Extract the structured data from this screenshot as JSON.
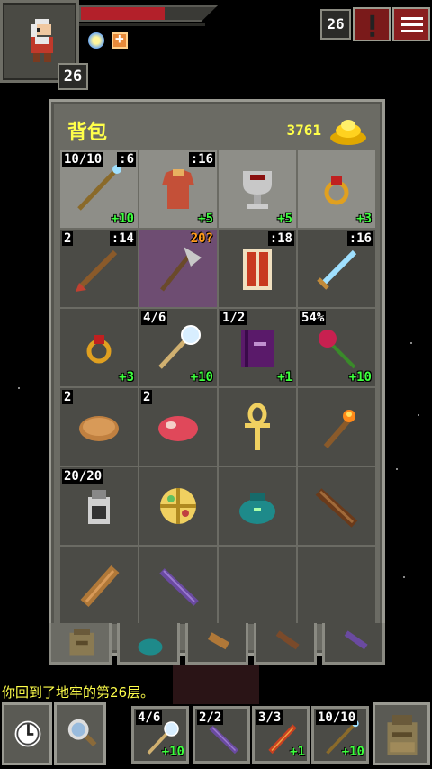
{
  "hud": {
    "hero_level": "26",
    "depth": "26",
    "hp_fraction": 0.62
  },
  "backpack": {
    "title": "背包",
    "gold": "3761",
    "slots": [
      {
        "name": "staff-icon",
        "tl": "10/10",
        "tr": ":6",
        "br": "+10",
        "state": "equipped"
      },
      {
        "name": "armor-icon",
        "tl": "",
        "tr": ":16",
        "br": "+5",
        "state": "equipped"
      },
      {
        "name": "chalice-artifact-icon",
        "tl": "",
        "tr": "",
        "br": "+5",
        "state": "equipped"
      },
      {
        "name": "ring-icon",
        "tl": "",
        "tr": "",
        "br": "+3",
        "state": "equipped"
      },
      {
        "name": "dart-icon",
        "tl": "2",
        "tr": ":14",
        "br": "",
        "state": ""
      },
      {
        "name": "axe-icon",
        "tl": "",
        "tr": "20?",
        "br": "",
        "state": "highlight"
      },
      {
        "name": "shield-icon",
        "tl": "",
        "tr": ":18",
        "br": "",
        "state": ""
      },
      {
        "name": "sword-icon",
        "tl": "",
        "tr": ":16",
        "br": "",
        "state": ""
      },
      {
        "name": "ring-icon",
        "tl": "",
        "tr": "",
        "br": "+3",
        "state": ""
      },
      {
        "name": "wand-icon",
        "tl": "4/6",
        "tr": "",
        "br": "+10",
        "state": ""
      },
      {
        "name": "spellbook-icon",
        "tl": "1/2",
        "tr": "",
        "br": "+1",
        "state": ""
      },
      {
        "name": "rose-icon",
        "tl": "54%",
        "tr": "",
        "br": "+10",
        "state": ""
      },
      {
        "name": "pasty-icon",
        "tl": "2",
        "tr": "",
        "br": "",
        "state": ""
      },
      {
        "name": "meat-icon",
        "tl": "2",
        "tr": "",
        "br": "",
        "state": ""
      },
      {
        "name": "ankh-icon",
        "tl": "",
        "tr": "",
        "br": "",
        "state": ""
      },
      {
        "name": "torch-icon",
        "tl": "",
        "tr": "",
        "br": "",
        "state": ""
      },
      {
        "name": "dew-vial-icon",
        "tl": "20/20",
        "tr": "",
        "br": "",
        "state": ""
      },
      {
        "name": "alchemy-pouch-icon",
        "tl": "",
        "tr": "",
        "br": "",
        "state": ""
      },
      {
        "name": "seed-pouch-icon",
        "tl": "",
        "tr": "",
        "br": "",
        "state": ""
      },
      {
        "name": "wand-holster-icon",
        "tl": "",
        "tr": "",
        "br": "",
        "state": ""
      },
      {
        "name": "scroll-holder-icon",
        "tl": "",
        "tr": "",
        "br": "",
        "state": ""
      },
      {
        "name": "wand-purple-icon",
        "tl": "",
        "tr": "",
        "br": "",
        "state": ""
      },
      {
        "name": "empty",
        "tl": "",
        "tr": "",
        "br": "",
        "state": ""
      },
      {
        "name": "empty",
        "tl": "",
        "tr": "",
        "br": "",
        "state": ""
      }
    ]
  },
  "tabs": [
    {
      "name": "tab-backpack",
      "icon": "backpack-icon"
    },
    {
      "name": "tab-seed-pouch",
      "icon": "seed-pouch-icon"
    },
    {
      "name": "tab-scroll-holder",
      "icon": "scroll-holder-icon"
    },
    {
      "name": "tab-wand-holster",
      "icon": "wand-holster-icon"
    },
    {
      "name": "tab-wand",
      "icon": "wand-icon"
    }
  ],
  "log": "你回到了地牢的第26层。",
  "quickslots": [
    {
      "tl": "4/6",
      "br": "+10",
      "icon": "wand-icon"
    },
    {
      "tl": "2/2",
      "br": "",
      "icon": "wand-purple-icon"
    },
    {
      "tl": "3/3",
      "br": "+1",
      "icon": "wand-fire-icon"
    },
    {
      "tl": "10/10",
      "br": "+10",
      "icon": "staff-icon"
    }
  ]
}
